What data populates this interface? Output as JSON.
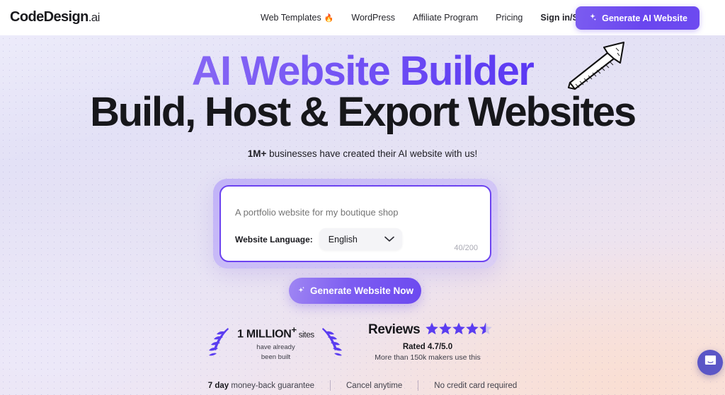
{
  "header": {
    "logo_bold": "CodeDesign",
    "logo_suffix": ".ai",
    "nav": [
      {
        "label": "Web Templates",
        "icon": "fire-icon",
        "emoji": "🔥",
        "bold": false
      },
      {
        "label": "WordPress",
        "icon": "",
        "emoji": "",
        "bold": false
      },
      {
        "label": "Affiliate Program",
        "icon": "",
        "emoji": "",
        "bold": false
      },
      {
        "label": "Pricing",
        "icon": "",
        "emoji": "",
        "bold": false
      },
      {
        "label": "Sign in/Sign up",
        "icon": "",
        "emoji": "",
        "bold": true
      }
    ],
    "cta_label": "Generate AI Website",
    "cta_icon": "sparkle-icon",
    "cta_color": "#6a46ef"
  },
  "hero": {
    "headline_top": "AI Website Builder",
    "headline_bottom": "Build, Host & Export Websites",
    "headline_gradient_from": "#9b7bf7",
    "headline_gradient_to": "#4b2bf2",
    "subtitle_bold": "1M+",
    "subtitle_rest": " businesses have created their AI website with us!",
    "doodle_icon": "hand-drawn-arrow-icon"
  },
  "prompt_card": {
    "input_value": "",
    "input_placeholder": "A portfolio website for my boutique shop",
    "language_label": "Website Language:",
    "language_value": "English",
    "language_caret_icon": "chevron-down-icon",
    "counter": "40/200",
    "border_color": "#6c43f0"
  },
  "generate_button": {
    "label": "Generate Website Now",
    "icon": "sparkle-icon"
  },
  "social_proof": {
    "million_number": "1 MILLION",
    "million_plus": "+",
    "million_sites": " sites",
    "million_line2": "have already",
    "million_line3": "been built",
    "laurel_icon": "laurel-wreath-icon",
    "reviews_title": "Reviews",
    "stars_icon": "star-icon",
    "stars_full": 4,
    "stars_half": 1,
    "star_color": "#5b3df0",
    "rated": "Rated 4.7/5.0",
    "makers": "More than 150k makers use this"
  },
  "bottom_bar": {
    "item1_bold": "7 day",
    "item1_rest": " money-back guarantee",
    "item2": "Cancel anytime",
    "item3": "No credit card required"
  },
  "chat_widget": {
    "icon": "chat-message-icon",
    "color": "#5b56c6"
  }
}
